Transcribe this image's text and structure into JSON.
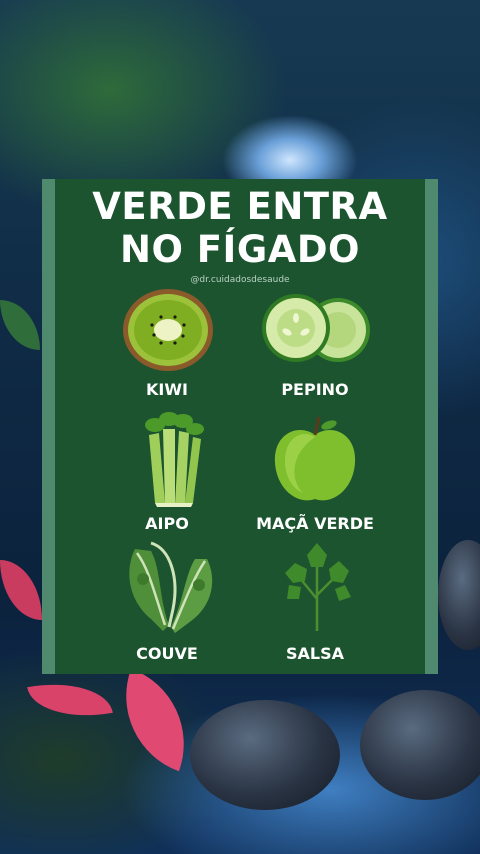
{
  "poster": {
    "title_line1": "VERDE ENTRA",
    "title_line2": "NO FÍGADO",
    "handle": "@dr.cuidadosdesaude",
    "items": [
      {
        "label": "KIWI",
        "icon": "kiwi-icon"
      },
      {
        "label": "PEPINO",
        "icon": "cucumber-icon"
      },
      {
        "label": "AIPO",
        "icon": "celery-icon"
      },
      {
        "label": "MAÇÃ VERDE",
        "icon": "green-apple-icon"
      },
      {
        "label": "COUVE",
        "icon": "kale-icon"
      },
      {
        "label": "SALSA",
        "icon": "parsley-icon"
      }
    ]
  },
  "colors": {
    "card_green": "#1d5430",
    "border_green": "#4f8a6e",
    "text": "#ffffff"
  }
}
